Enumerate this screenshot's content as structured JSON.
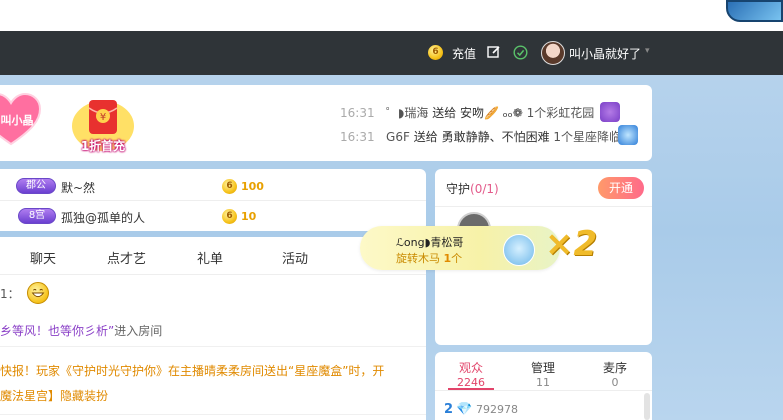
{
  "topbar": {
    "coin_glyph": "6",
    "recharge_label": "充值",
    "username": "叫小晶就好了",
    "caret": "▾"
  },
  "promo": {
    "heart_label": "叫小晶",
    "first_recharge_label": "1折首充",
    "envelope_glyph": "¥"
  },
  "gift_messages": [
    {
      "time": "16:31",
      "user": "゜◗瑞海",
      "action": "送给",
      "target": "安吻🥖 ₒₒ❁",
      "gift": "1个彩虹花园"
    },
    {
      "time": "16:31",
      "user": "G6F",
      "action": "送给",
      "target": "勇敢静静、不怕困难",
      "gift": "1个星座降临"
    }
  ],
  "rank": [
    {
      "badge": "郡公",
      "name": "默~然",
      "value": "100"
    },
    {
      "badge": "8宫",
      "name": "孤独@孤单的人",
      "value": "10"
    }
  ],
  "chat_tabs": [
    "聊天",
    "点才艺",
    "礼单",
    "活动"
  ],
  "chat": {
    "line1_prefix": "1：",
    "line2_quote": "乡等风！也等你彡析”",
    "line2_suffix": "进入房间",
    "line3": "快报！玩家《守护时光守护你》在主播晴柔柔房间送出“星座魔盒”时，开",
    "line4": "魔法星宫】隐藏装扮"
  },
  "guard": {
    "title": "守护",
    "count": "(0/1)",
    "open_label": "开通"
  },
  "toast": {
    "user": "ℒong◗青松哥",
    "gift_name": "旋转木马",
    "gift_count": "1",
    "gift_unit": "个",
    "multiplier": "×2"
  },
  "audience": {
    "tabs": [
      {
        "label": "观众",
        "count": "2246",
        "active": true
      },
      {
        "label": "管理",
        "count": "11",
        "active": false
      },
      {
        "label": "麦序",
        "count": "0",
        "active": false
      }
    ],
    "first_rank": "2",
    "gem_glyph": "💎",
    "first_score": "792978"
  },
  "colors": {
    "accent_pink": "#e2446a",
    "topbar_bg": "#2f3438",
    "coin_gold": "#f6c21a"
  }
}
